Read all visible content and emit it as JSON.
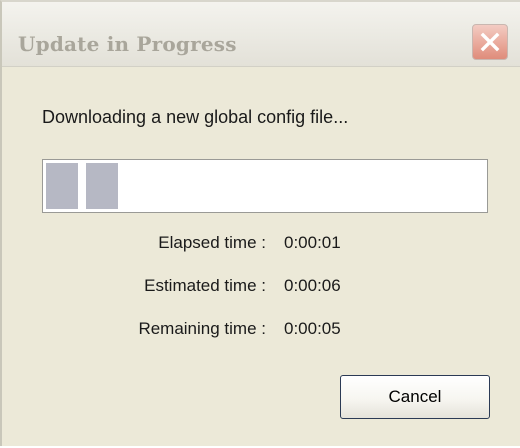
{
  "dialog": {
    "title": "Update in Progress",
    "close_icon": "close-icon",
    "message": "Downloading a new global config file...",
    "progress_fraction": 0.16,
    "stats": [
      {
        "label": "Elapsed time :",
        "value": "0:00:01"
      },
      {
        "label": "Estimated time :",
        "value": "0:00:06"
      },
      {
        "label": "Remaining time :",
        "value": "0:00:05"
      }
    ],
    "cancel_label": "Cancel"
  },
  "colors": {
    "title_text": "#a9a69b",
    "progress_block": "#b6b8c4",
    "close_button": "#e9a99b",
    "window_bg": "#ece9d8"
  }
}
